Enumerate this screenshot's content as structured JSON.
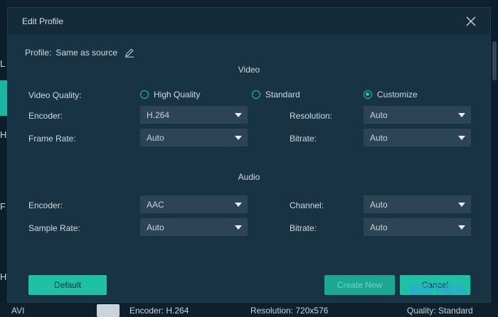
{
  "background": {
    "left_items": [
      "L",
      "HE",
      "F",
      "HE",
      "AVI"
    ],
    "bottom": {
      "encoder": "Encoder: H.264",
      "resolution": "Resolution: 720x576",
      "quality": "Quality: Standard"
    }
  },
  "dialog": {
    "title": "Edit Profile",
    "profile_label": "Profile:",
    "profile_value": "Same as source",
    "video": {
      "section_title": "Video",
      "quality_label": "Video Quality:",
      "quality_options": [
        "High Quality",
        "Standard",
        "Customize"
      ],
      "quality_selected": "Customize",
      "encoder_label": "Encoder:",
      "encoder_value": "H.264",
      "resolution_label": "Resolution:",
      "resolution_value": "Auto",
      "frame_rate_label": "Frame Rate:",
      "frame_rate_value": "Auto",
      "bitrate_label": "Bitrate:",
      "bitrate_value": "Auto"
    },
    "audio": {
      "section_title": "Audio",
      "encoder_label": "Encoder:",
      "encoder_value": "AAC",
      "channel_label": "Channel:",
      "channel_value": "Auto",
      "sample_rate_label": "Sample Rate:",
      "sample_rate_value": "Auto",
      "bitrate_label": "Bitrate:",
      "bitrate_value": "Auto"
    },
    "buttons": {
      "default": "Default",
      "create_new": "Create New",
      "cancel": "Cancel"
    }
  },
  "watermark": "极光下载站",
  "colors": {
    "accent": "#1ec0a6",
    "dialog_bg": "#173344",
    "field_bg": "#2c4455"
  },
  "icons": [
    "close-icon",
    "edit-pencil-icon",
    "dropdown-caret-icon",
    "radio-icon"
  ]
}
